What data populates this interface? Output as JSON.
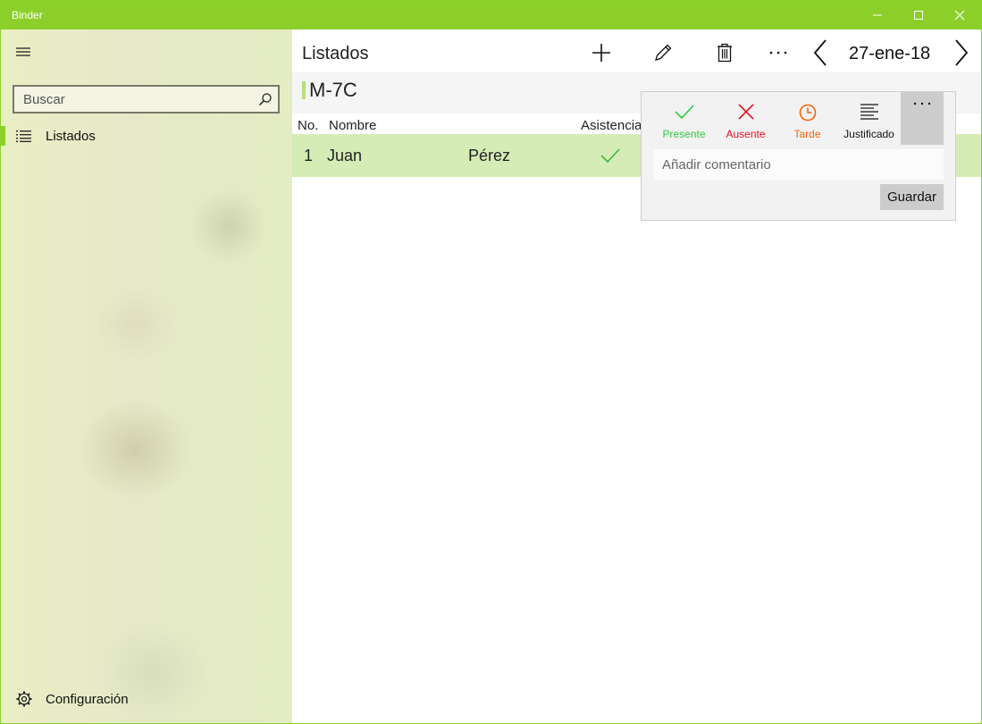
{
  "window": {
    "title": "Binder"
  },
  "sidebar": {
    "search": {
      "placeholder": "Buscar"
    },
    "items": [
      {
        "label": "Listados",
        "icon": "list-icon",
        "selected": true
      }
    ],
    "settings": {
      "label": "Configuración",
      "icon": "gear-icon"
    }
  },
  "header": {
    "title": "Listados",
    "date": "27-ene-18"
  },
  "group": {
    "name": "M-7C"
  },
  "table": {
    "columns": [
      "No.",
      "Nombre",
      "Asistencia"
    ],
    "rows": [
      {
        "no": "1",
        "first": "Juan",
        "last": "Pérez",
        "status": "present"
      }
    ]
  },
  "flyout": {
    "statuses": [
      {
        "label": "Presente",
        "color": "#2ecc40",
        "icon": "check-icon"
      },
      {
        "label": "Ausente",
        "color": "#e81123",
        "icon": "close-icon"
      },
      {
        "label": "Tarde",
        "color": "#f7630c",
        "icon": "clock-icon"
      },
      {
        "label": "Justificado",
        "color": "#111111",
        "icon": "text-align-icon"
      }
    ],
    "comment_placeholder": "Añadir comentario",
    "save_label": "Guardar"
  },
  "colors": {
    "accent": "#8ccf2a",
    "row_highlight": "#d5ecb6"
  }
}
